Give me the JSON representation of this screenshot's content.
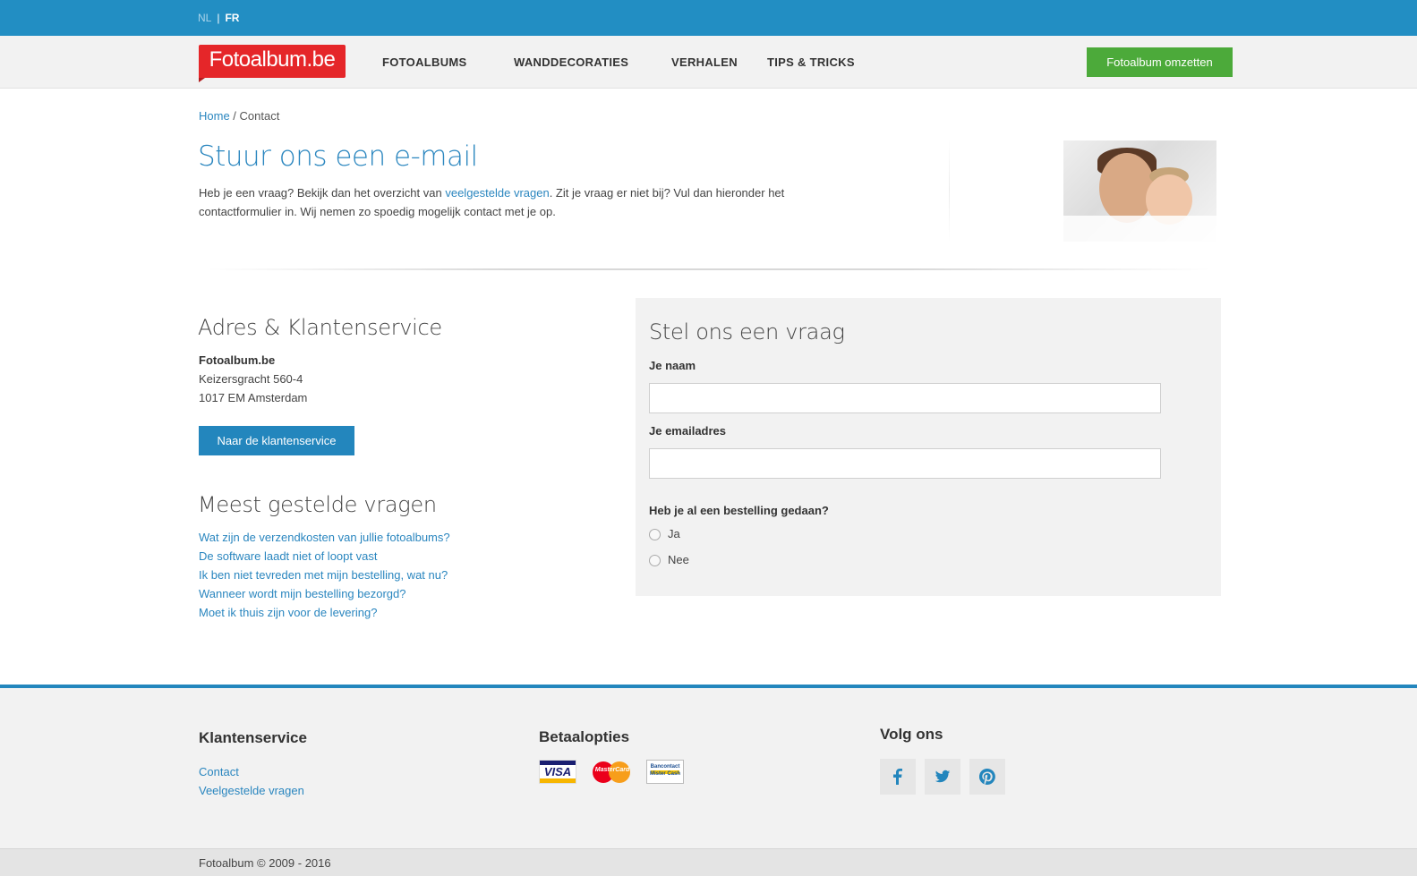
{
  "lang": {
    "nl": "NL",
    "separator": "|",
    "fr": "FR"
  },
  "brand": {
    "logo_text": "Fotoalbum.be",
    "logo_color": "#e52629",
    "accent_color": "#228ec3",
    "cta_color": "#4caa3a"
  },
  "nav": {
    "items": [
      "FOTOALBUMS",
      "WANDDECORATIES",
      "VERHALEN",
      "TIPS & TRICKS"
    ],
    "cta_label": "Fotoalbum omzetten"
  },
  "breadcrumb": {
    "home": "Home",
    "separator": " / ",
    "current": "Contact"
  },
  "intro": {
    "title": "Stuur ons een e-mail",
    "text_before_link": "Heb je een vraag? Bekijk dan het overzicht van ",
    "link_text": "veelgestelde vragen",
    "text_after_link": ". Zit je vraag er niet bij? Vul dan hieronder het contactformulier in. Wij nemen zo spoedig mogelijk contact met je op."
  },
  "address": {
    "title": "Adres & Klantenservice",
    "company": "Fotoalbum.be",
    "street": "Keizersgracht 560-4",
    "city": "1017 EM Amsterdam",
    "button_label": "Naar de klantenservice"
  },
  "faq": {
    "title": "Meest gestelde vragen",
    "items": [
      "Wat zijn de verzendkosten van jullie fotoalbums?",
      "De software laadt niet of loopt vast",
      "Ik ben niet tevreden met mijn bestelling, wat nu?",
      "Wanneer wordt mijn bestelling bezorgd?",
      "Moet ik thuis zijn voor de levering?"
    ]
  },
  "form": {
    "title": "Stel ons een vraag",
    "name_label": "Je naam",
    "name_value": "",
    "email_label": "Je emailadres",
    "email_value": "",
    "order_question": "Heb je al een bestelling gedaan?",
    "options": [
      "Ja",
      "Nee"
    ]
  },
  "footer": {
    "service_title": "Klantenservice",
    "service_links": [
      "Contact",
      "Veelgestelde vragen"
    ],
    "payment_title": "Betaalopties",
    "payment_methods": [
      "VISA",
      "MasterCard",
      "Bancontact Mister Cash"
    ],
    "follow_title": "Volg ons",
    "social": [
      "facebook-icon",
      "twitter-icon",
      "pinterest-icon"
    ],
    "copyright": "Fotoalbum © 2009 - 2016"
  }
}
